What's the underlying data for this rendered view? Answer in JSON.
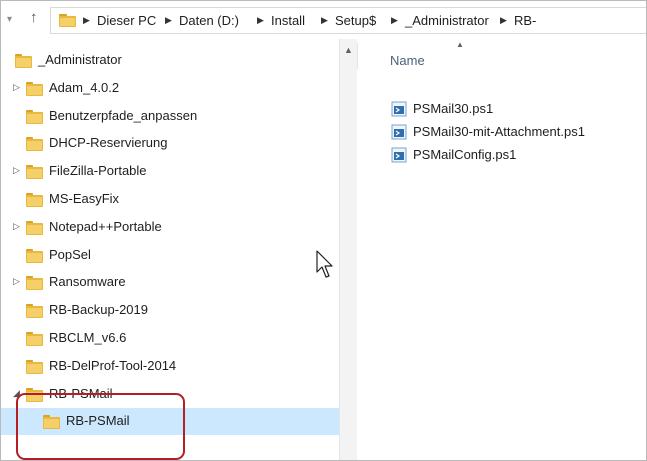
{
  "address": {
    "segments": [
      "Dieser PC",
      "Daten (D:)",
      "Install",
      "Setup$",
      "_Administrator",
      "RB-"
    ]
  },
  "tree": {
    "items": [
      {
        "label": "_Administrator",
        "indent": 0,
        "expander": ""
      },
      {
        "label": "Adam_4.0.2",
        "indent": 1,
        "expander": "▷"
      },
      {
        "label": "Benutzerpfade_anpassen",
        "indent": 1,
        "expander": ""
      },
      {
        "label": "DHCP-Reservierung",
        "indent": 1,
        "expander": ""
      },
      {
        "label": "FileZilla-Portable",
        "indent": 1,
        "expander": "▷"
      },
      {
        "label": "MS-EasyFix",
        "indent": 1,
        "expander": ""
      },
      {
        "label": "Notepad++Portable",
        "indent": 1,
        "expander": "▷"
      },
      {
        "label": "PopSel",
        "indent": 1,
        "expander": ""
      },
      {
        "label": "Ransomware",
        "indent": 1,
        "expander": "▷"
      },
      {
        "label": "RB-Backup-2019",
        "indent": 1,
        "expander": ""
      },
      {
        "label": "RBCLM_v6.6",
        "indent": 1,
        "expander": ""
      },
      {
        "label": "RB-DelProf-Tool-2014",
        "indent": 1,
        "expander": ""
      },
      {
        "label": "RB-PSMail",
        "indent": 1,
        "expander": "◢"
      },
      {
        "label": "RB-PSMail",
        "indent": 2,
        "expander": "",
        "selected": true
      }
    ]
  },
  "files": {
    "column_name": "Name",
    "items": [
      {
        "name": "PSMail30.ps1"
      },
      {
        "name": "PSMail30-mit-Attachment.ps1"
      },
      {
        "name": "PSMailConfig.ps1"
      }
    ]
  },
  "colors": {
    "folder": "#e8b93b",
    "selection": "#cce8ff",
    "highlight": "#b51f24"
  }
}
